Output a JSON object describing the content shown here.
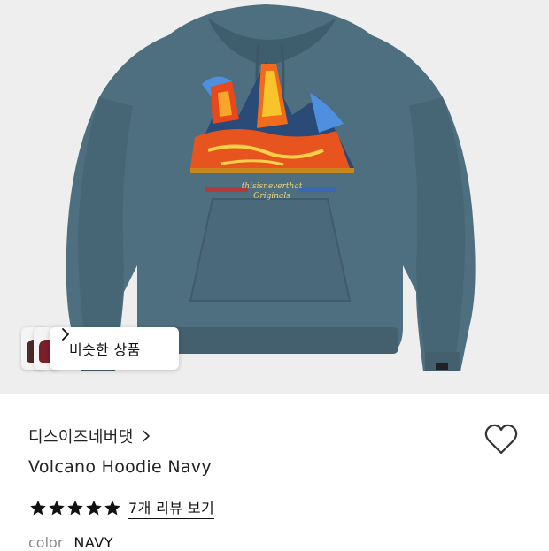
{
  "similar": {
    "label": "비슷한 상품"
  },
  "product": {
    "brand": "디스이즈네버댓",
    "title": "Volcano Hoodie Navy",
    "rating": 5,
    "review_link": "7개 리뷰 보기",
    "color_label": "color",
    "color_value": "NAVY"
  },
  "print": {
    "brand_text": "thisisneverthat",
    "sub_text": "Originals"
  },
  "colors": {
    "hoodie": "#4e6f80",
    "star": "#111111",
    "muted": "#8a8a8a"
  },
  "icons": [
    "chevron-right-icon",
    "heart-icon",
    "star-icon"
  ]
}
